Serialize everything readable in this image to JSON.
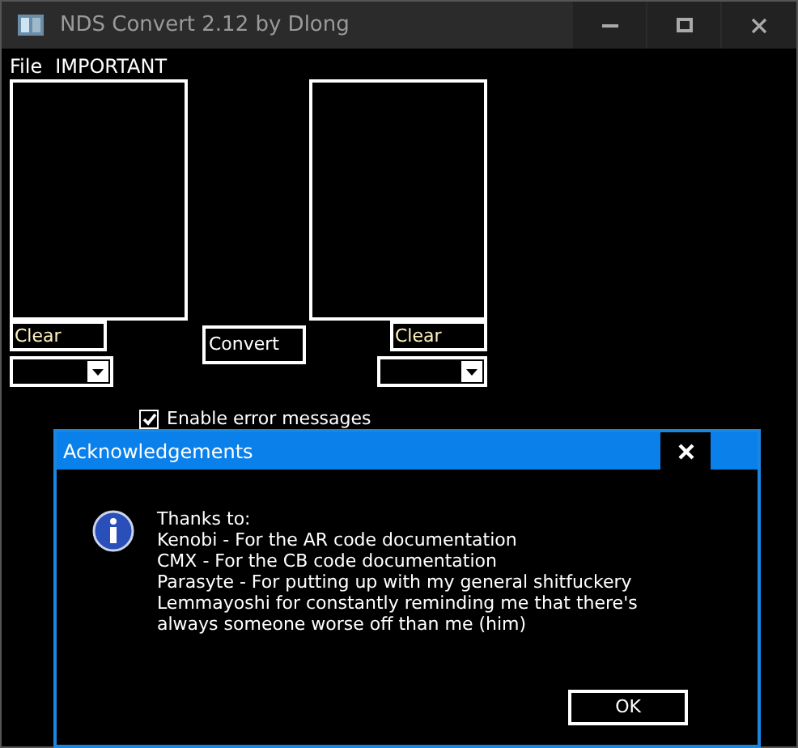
{
  "window": {
    "title": "NDS Convert 2.12 by Dlong"
  },
  "menu": [
    {
      "label": "File"
    },
    {
      "label": "IMPORTANT"
    }
  ],
  "left_panel": {
    "clear_field": "Clear"
  },
  "convert_button": "Convert",
  "right_panel": {
    "clear_field": "Clear"
  },
  "error_messages": {
    "label": "Enable error messages",
    "checked": true
  },
  "dialog": {
    "title": "Acknowledgements",
    "lines": [
      "Thanks to:",
      "Kenobi - For the AR code documentation",
      "CMX - For the CB code documentation",
      "Parasyte - For putting up with my general shitfuckery",
      "Lemmayoshi for constantly reminding me that there's always someone worse off than me (him)"
    ],
    "button": "OK"
  }
}
